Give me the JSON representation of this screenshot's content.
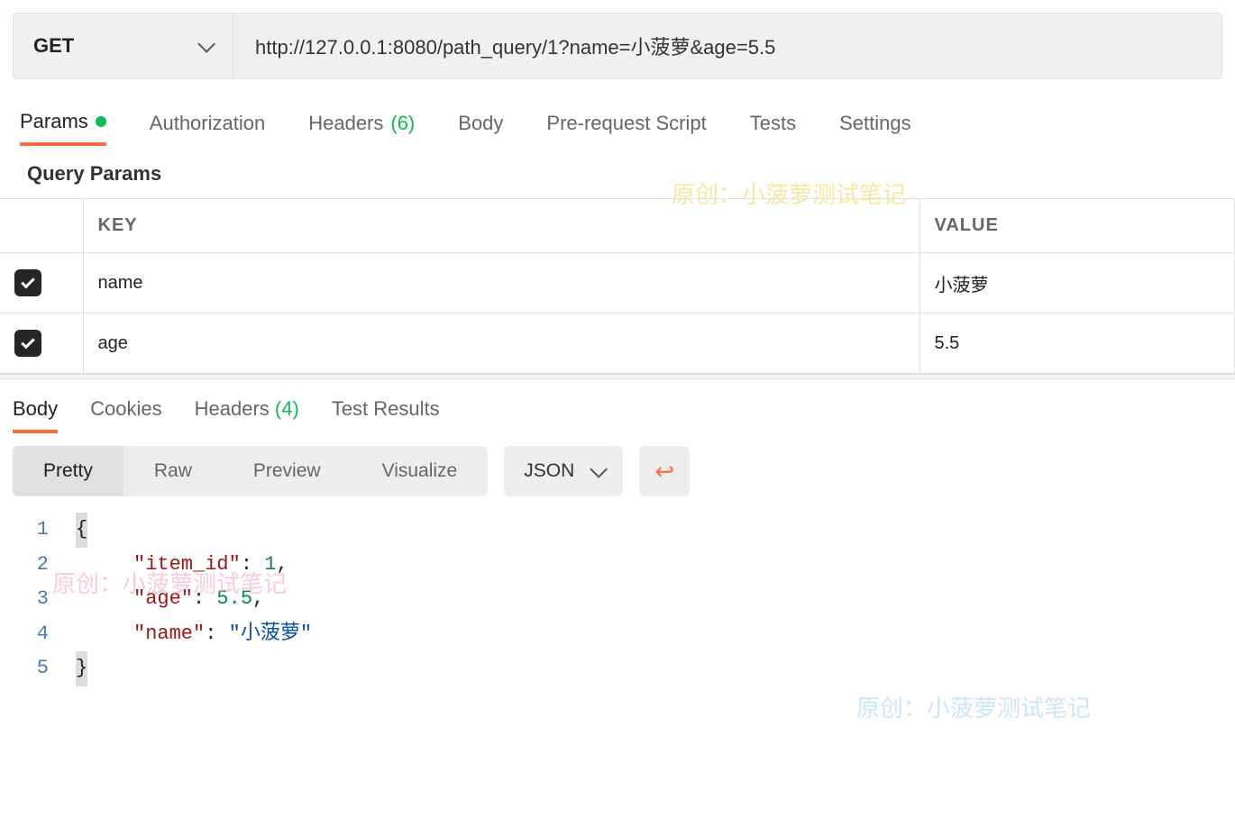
{
  "request": {
    "method": "GET",
    "url": "http://127.0.0.1:8080/path_query/1?name=小菠萝&age=5.5"
  },
  "reqTabs": {
    "params": "Params",
    "authorization": "Authorization",
    "headers": "Headers",
    "headersCount": "(6)",
    "body": "Body",
    "prerequest": "Pre-request Script",
    "tests": "Tests",
    "settings": "Settings"
  },
  "sectionTitle": "Query Params",
  "paramsTable": {
    "keyHeader": "KEY",
    "valueHeader": "VALUE",
    "rows": [
      {
        "key": "name",
        "value": "小菠萝"
      },
      {
        "key": "age",
        "value": "5.5"
      }
    ]
  },
  "respTabs": {
    "body": "Body",
    "cookies": "Cookies",
    "headers": "Headers",
    "headersCount": "(4)",
    "testResults": "Test Results"
  },
  "viewModes": {
    "pretty": "Pretty",
    "raw": "Raw",
    "preview": "Preview",
    "visualize": "Visualize"
  },
  "formatSelect": "JSON",
  "code": {
    "lines": [
      "1",
      "2",
      "3",
      "4",
      "5"
    ],
    "l1": "{",
    "l2key": "\"item_id\"",
    "l2colon": ": ",
    "l2val": "1",
    "l2comma": ",",
    "l3key": "\"age\"",
    "l3colon": ": ",
    "l3val": "5.5",
    "l3comma": ",",
    "l4key": "\"name\"",
    "l4colon": ": ",
    "l4val": "\"小菠萝\"",
    "l5": "}"
  },
  "watermark": "原创：小菠萝测试笔记"
}
